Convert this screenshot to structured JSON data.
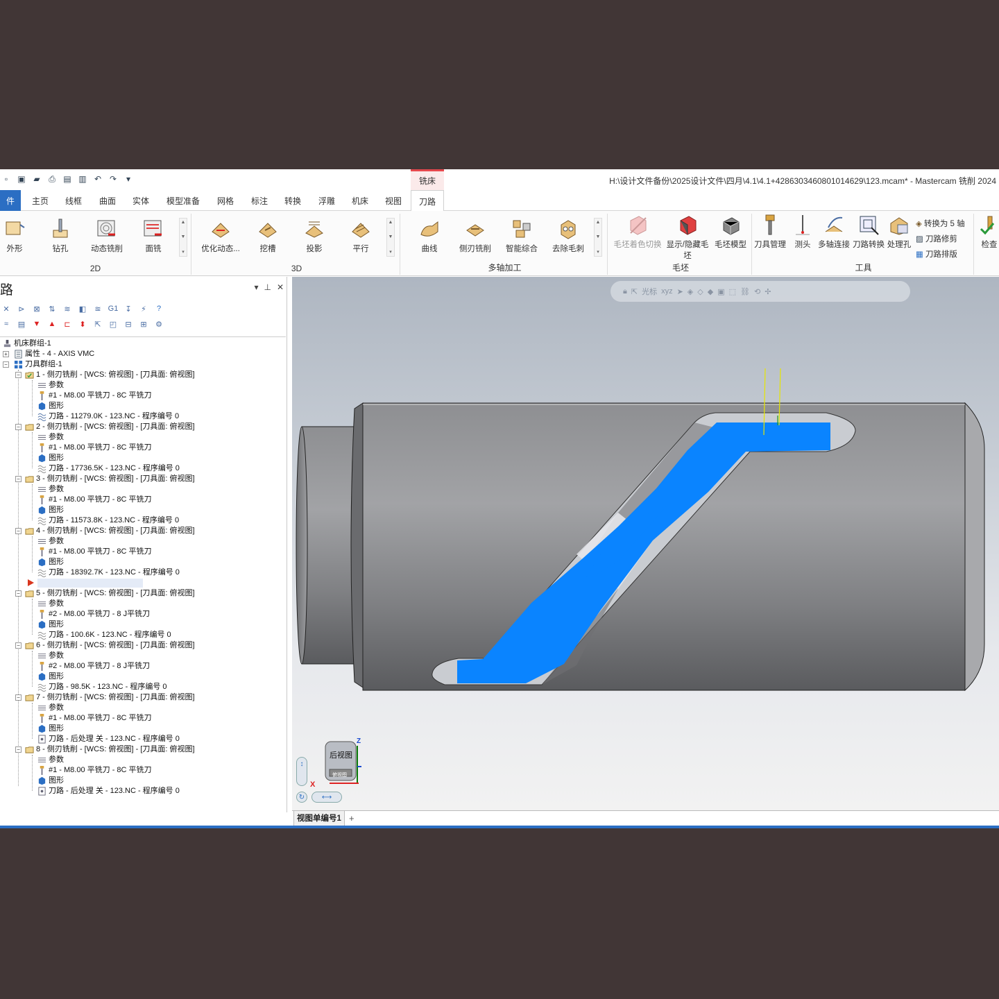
{
  "window": {
    "title": "H:\\设计文件备份\\2025设计文件\\四月\\4.1\\4.1+4286303460801014629\\123.mcam* - Mastercam 铣削 2024",
    "context_tab": "铣床"
  },
  "tabs": [
    "件",
    "主页",
    "线框",
    "曲面",
    "实体",
    "模型准备",
    "网格",
    "标注",
    "转换",
    "浮雕",
    "机床",
    "视图",
    "刀路"
  ],
  "ribbon": {
    "groups": {
      "g2d": "2D",
      "g3d": "3D",
      "multi": "多轴加工",
      "stock": "毛坯",
      "tools": "工具"
    },
    "buttons_2d": [
      "外形",
      "钻孔",
      "动态铣削",
      "面铣"
    ],
    "buttons_3d": [
      "优化动态...",
      "挖槽",
      "投影",
      "平行"
    ],
    "buttons_multi": [
      "曲线",
      "侧刃铣削",
      "智能综合",
      "去除毛刺"
    ],
    "buttons_stock": [
      "毛坯着色切换",
      "显示/隐藏毛坯",
      "毛坯模型"
    ],
    "buttons_tools": [
      "刀具管理",
      "测头",
      "多轴连接",
      "刀路转换",
      "处理孔"
    ],
    "small_tools": [
      "转换为 5 轴",
      "刀路修剪",
      "刀路排版"
    ],
    "check": "检查"
  },
  "panel": {
    "title": "路",
    "root": "机床群组-1",
    "properties": "属性 - 4 - AXIS VMC",
    "toolgroup": "刀具群组-1",
    "ops": [
      {
        "title": "1 - 侧刃铣削 - [WCS: 俯视图] - [刀具面: 俯视图]",
        "params": "参数",
        "tool": "#1 - M8.00 平铣刀 - 8C 平铣刀",
        "geom": "图形",
        "path": "刀路 - 11279.0K - 123.NC - 程序编号 0"
      },
      {
        "title": "2 - 侧刃铣削 - [WCS: 俯视图] - [刀具面: 俯视图]",
        "params": "参数",
        "tool": "#1 - M8.00 平铣刀 - 8C 平铣刀",
        "geom": "图形",
        "path": "刀路 - 17736.5K - 123.NC - 程序编号 0"
      },
      {
        "title": "3 - 侧刃铣削 - [WCS: 俯视图] - [刀具面: 俯视图]",
        "params": "参数",
        "tool": "#1 - M8.00 平铣刀 - 8C 平铣刀",
        "geom": "图形",
        "path": "刀路 - 11573.8K - 123.NC - 程序编号 0"
      },
      {
        "title": "4 - 侧刃铣削 - [WCS: 俯视图] - [刀具面: 俯视图]",
        "params": "参数",
        "tool": "#1 - M8.00 平铣刀 - 8C 平铣刀",
        "geom": "图形",
        "path": "刀路 - 18392.7K - 123.NC - 程序编号 0"
      },
      {
        "title": "5 - 侧刃铣削 - [WCS: 俯视图] - [刀具面: 俯视图]",
        "params": "参数",
        "tool": "#2 - M8.00 平铣刀 - 8 J平铣刀",
        "geom": "图形",
        "path": "刀路 - 100.6K - 123.NC - 程序编号 0"
      },
      {
        "title": "6 - 侧刃铣削 - [WCS: 俯视图] - [刀具面: 俯视图]",
        "params": "参数",
        "tool": "#2 - M8.00 平铣刀 - 8 J平铣刀",
        "geom": "图形",
        "path": "刀路 - 98.5K - 123.NC - 程序编号 0"
      },
      {
        "title": "7 - 侧刃铣削 - [WCS: 俯视图] - [刀具面: 俯视图]",
        "params": "参数",
        "tool": "#1 - M8.00 平铣刀 - 8C 平铣刀",
        "geom": "图形",
        "path": "刀路 - 后处理 关 - 123.NC - 程序编号 0"
      },
      {
        "title": "8 - 侧刃铣削 - [WCS: 俯视图] - [刀具面: 俯视图]",
        "params": "参数",
        "tool": "#1 - M8.00 平铣刀 - 8C 平铣刀",
        "geom": "图形",
        "path": "刀路 - 后处理 关 - 123.NC - 程序编号 0"
      }
    ]
  },
  "viewport": {
    "toolbar_label": "光标",
    "viewcube_front": "后视图",
    "viewcube_bottom": "俯视图",
    "axis_x": "X",
    "axis_z": "Z",
    "accent_toolpath": "#0a84ff"
  },
  "viewtabs": {
    "tab1": "视图单编号1",
    "add": "+"
  }
}
